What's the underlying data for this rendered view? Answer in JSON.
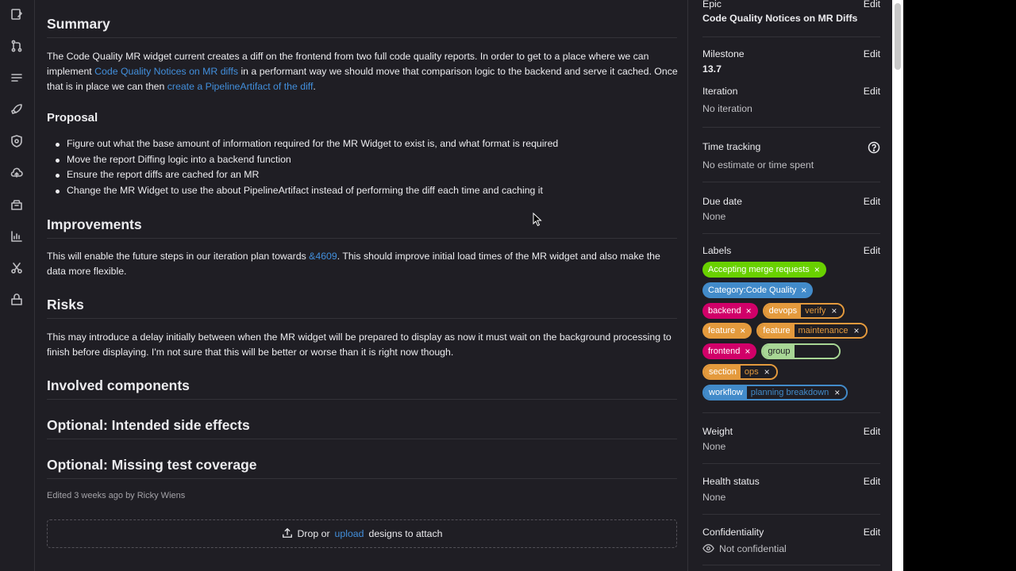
{
  "nav": {
    "icons": [
      "issues-icon",
      "merge-request-icon",
      "requirements-icon",
      "rocket-icon",
      "shield-icon",
      "cloud-icon",
      "package-icon",
      "chart-icon",
      "snippet-icon",
      "project-icon"
    ]
  },
  "main": {
    "summary_heading": "Summary",
    "summary_text_1": "The Code Quality MR widget current creates a diff on the frontend from two full code quality reports. In order to get to a place where we can implement ",
    "summary_link_1": "Code Quality Notices on MR diffs",
    "summary_text_2": " in a performant way we should move that comparison logic to the backend and serve it cached. Once that is in place we can then ",
    "summary_link_2": "create a PipelineArtifact of the diff",
    "summary_text_3": ".",
    "proposal_heading": "Proposal",
    "proposal_items": [
      "Figure out what the base amount of information required for the MR Widget to exist is, and what format is required",
      "Move the report Diffing logic into a backend function",
      "Ensure the report diffs are cached for an MR",
      "Change the MR Widget to use the about PipelineArtifact instead of performing the diff each time and caching it"
    ],
    "improvements_heading": "Improvements",
    "improvements_text_1": "This will enable the future steps in our iteration plan towards ",
    "improvements_link": "&4609",
    "improvements_text_2": ". This should improve initial load times of the MR widget and also make the data more flexible.",
    "risks_heading": "Risks",
    "risks_text": "This may introduce a delay initially between when the MR widget will be prepared to display as now it must wait on the background processing to finish before displaying. I'm not sure that this will be better or worse than it is right now though.",
    "involved_heading": "Involved components",
    "side_effects_heading": "Optional: Intended side effects",
    "coverage_heading": "Optional: Missing test coverage",
    "edited_text": "Edited 3 weeks ago by Ricky Wiens",
    "drop_text_1": "Drop or",
    "drop_link": "upload",
    "drop_text_2": "designs to attach"
  },
  "sidebar": {
    "edit_label": "Edit",
    "epic": {
      "title": "Epic",
      "value": "Code Quality Notices on MR Diffs"
    },
    "milestone": {
      "title": "Milestone",
      "value": "13.7"
    },
    "iteration": {
      "title": "Iteration",
      "value": "No iteration"
    },
    "time_tracking": {
      "title": "Time tracking",
      "value": "No estimate or time spent"
    },
    "due_date": {
      "title": "Due date",
      "value": "None"
    },
    "labels_title": "Labels",
    "weight": {
      "title": "Weight",
      "value": "None"
    },
    "health": {
      "title": "Health status",
      "value": "None"
    },
    "confidentiality": {
      "title": "Confidentiality",
      "value": "Not confidential"
    }
  },
  "labels": {
    "accepting": "Accepting merge requests",
    "category": "Category:Code Quality",
    "backend": "backend",
    "devops_key": "devops",
    "devops_val": "verify",
    "feature": "feature",
    "feature_key": "feature",
    "feature_val": "maintenance",
    "frontend": "frontend",
    "group_key": "group",
    "group_val": "",
    "section_key": "section",
    "section_val": "ops",
    "workflow_key": "workflow",
    "workflow_val": "planning breakdown",
    "remove_glyph": "×"
  },
  "colors": {
    "accepting": "#69d100",
    "category": "#428bca",
    "backend": "#d10069",
    "devops": "#e49a3d",
    "feature": "#e49a3d",
    "frontend": "#d10069",
    "group": "#a8d695",
    "section": "#e49a3d",
    "workflow": "#428bca",
    "link": "#428fdc"
  }
}
